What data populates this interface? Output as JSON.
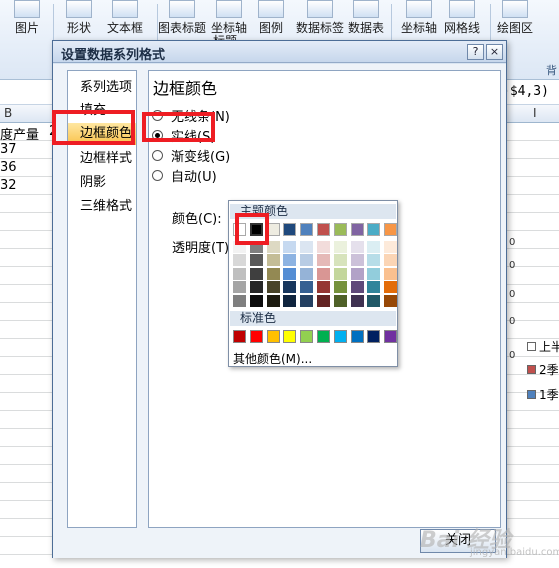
{
  "ribbon": {
    "buttons": [
      {
        "label": "图片",
        "icon": "picture-icon"
      },
      {
        "label": "形状",
        "icon": "shapes-icon"
      },
      {
        "label": "文本框",
        "icon": "textbox-icon"
      },
      {
        "label": "图表标题",
        "icon": "chart-title-icon"
      },
      {
        "label": "坐标轴",
        "icon": "axis-title-icon"
      },
      {
        "label": "图例",
        "icon": "legend-icon"
      },
      {
        "label": "数据标签",
        "icon": "data-labels-icon"
      },
      {
        "label": "数据表",
        "icon": "data-table-icon"
      },
      {
        "label": "坐标轴",
        "icon": "axes-icon"
      },
      {
        "label": "网格线",
        "icon": "gridlines-icon"
      },
      {
        "label": "绘图区",
        "icon": "plot-area-icon"
      }
    ],
    "partial_sub_label": "标题",
    "group_tail": "背"
  },
  "formula_bar": {
    "text": ")$4,3)"
  },
  "columns": {
    "b": "B",
    "i": "I"
  },
  "cells": {
    "b1": "度产量",
    "b1_suffix": "2",
    "b2": "37",
    "b3": "36",
    "b4": "32"
  },
  "chart": {
    "legend": [
      {
        "label": "上半",
        "color": "#ffffff"
      },
      {
        "label": "2季",
        "color": "#c0504d"
      },
      {
        "label": "1季",
        "color": "#4f81bd"
      }
    ]
  },
  "dialog": {
    "title": "设置数据系列格式",
    "help_label": "?",
    "close_label": "×",
    "nav": [
      "系列选项",
      "填充",
      "边框颜色",
      "边框样式",
      "阴影",
      "三维格式"
    ],
    "selected_nav": "边框颜色",
    "section_title": "边框颜色",
    "options": {
      "none": "无线条(N)",
      "solid": "实线(S)",
      "gradient": "渐变线(G)",
      "auto": "自动(U)"
    },
    "selected_option": "实线(S)",
    "color_label": "颜色(C):",
    "transparency_label": "透明度(T):",
    "close_button": "关闭"
  },
  "color_popup": {
    "theme_header": "主题颜色",
    "standard_header": "标准色",
    "more_colors": "其他颜色(M)...",
    "selected_color": "#000000",
    "theme_top": [
      "#ffffff",
      "#000000",
      "#eeece1",
      "#1f497d",
      "#4f81bd",
      "#c0504d",
      "#9bbb59",
      "#8064a2",
      "#4bacc6",
      "#f79646"
    ],
    "theme_shades": [
      [
        "#f2f2f2",
        "#d8d8d8",
        "#bfbfbf",
        "#a5a5a5",
        "#7f7f7f"
      ],
      [
        "#7f7f7f",
        "#595959",
        "#3f3f3f",
        "#262626",
        "#0c0c0c"
      ],
      [
        "#ddd9c3",
        "#c4bd97",
        "#938953",
        "#494429",
        "#1d1b10"
      ],
      [
        "#c6d9f0",
        "#8db3e2",
        "#548dd4",
        "#17365d",
        "#0f243e"
      ],
      [
        "#dbe5f1",
        "#b8cce4",
        "#95b3d7",
        "#366092",
        "#244061"
      ],
      [
        "#f2dcdb",
        "#e5b9b7",
        "#d99694",
        "#953734",
        "#632423"
      ],
      [
        "#ebf1dd",
        "#d7e3bc",
        "#c3d69b",
        "#76923c",
        "#4f6128"
      ],
      [
        "#e5e0ec",
        "#ccc1d9",
        "#b2a2c7",
        "#5f497a",
        "#3f3151"
      ],
      [
        "#dbeef3",
        "#b7dde8",
        "#92cddc",
        "#31859b",
        "#205867"
      ],
      [
        "#fdeada",
        "#fbd5b5",
        "#fac08f",
        "#e36c09",
        "#974806"
      ]
    ],
    "standard": [
      "#c00000",
      "#ff0000",
      "#ffc000",
      "#ffff00",
      "#92d050",
      "#00b050",
      "#00b0f0",
      "#0070c0",
      "#002060",
      "#7030a0"
    ]
  },
  "watermark": {
    "logo": "Bai 经验",
    "sub": "jingyan.baidu.com"
  }
}
